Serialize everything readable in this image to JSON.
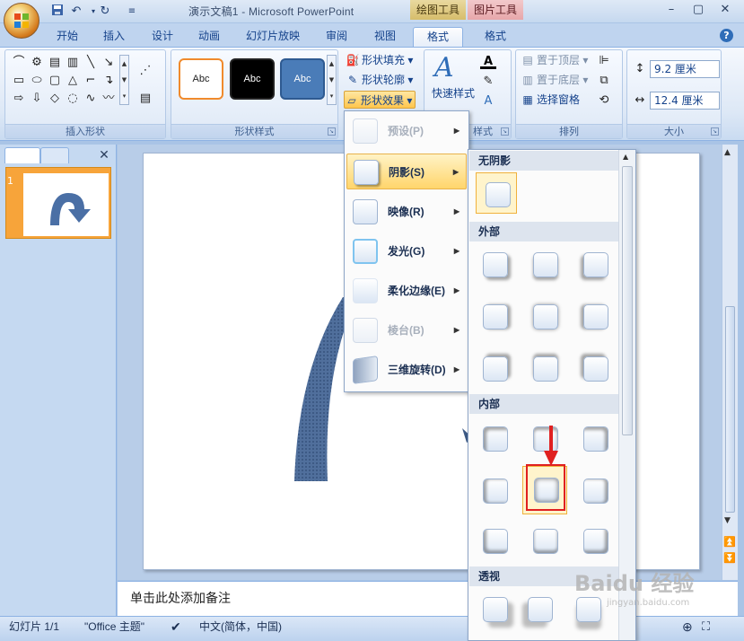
{
  "app": {
    "title": "演示文稿1 - Microsoft PowerPoint",
    "context_tabs": {
      "drawing": "绘图工具",
      "picture": "图片工具"
    }
  },
  "window_controls": {
    "minimize": "–",
    "restore": "▢",
    "close": "✕"
  },
  "tabs": [
    "开始",
    "插入",
    "设计",
    "动画",
    "幻灯片放映",
    "审阅",
    "视图",
    "格式",
    "格式"
  ],
  "active_tab_index": 7,
  "ribbon": {
    "insert_shapes": {
      "label": "插入形状"
    },
    "shape_styles": {
      "label": "形状样式",
      "thumbnails": [
        "Abc",
        "Abc",
        "Abc"
      ],
      "fill": "形状填充",
      "outline": "形状轮廓",
      "effects": "形状效果"
    },
    "wordart": {
      "quick_styles": "快速样式",
      "label_fragment": "样式"
    },
    "arrange": {
      "label": "排列",
      "bring_front": "置于顶层",
      "send_back": "置于底层",
      "selection_pane": "选择窗格"
    },
    "size": {
      "label": "大小",
      "height": "9.2 厘米",
      "width": "12.4 厘米"
    }
  },
  "effects_menu": {
    "items": [
      {
        "label": "预设(P)",
        "disabled": true
      },
      {
        "label": "阴影(S)",
        "disabled": false,
        "hot": true
      },
      {
        "label": "映像(R)",
        "disabled": false
      },
      {
        "label": "发光(G)",
        "disabled": false
      },
      {
        "label": "柔化边缘(E)",
        "disabled": false
      },
      {
        "label": "棱台(B)",
        "disabled": true
      },
      {
        "label": "三维旋转(D)",
        "disabled": false
      }
    ]
  },
  "shadow_gallery": {
    "sections": {
      "none": "无阴影",
      "outer": "外部",
      "inner": "内部",
      "perspective": "透视"
    }
  },
  "notes": {
    "placeholder": "单击此处添加备注"
  },
  "status": {
    "slide": "幻灯片 1/1",
    "theme": "\"Office 主题\"",
    "language": "中文(简体，中国)"
  },
  "slides_panel": {
    "number": "1"
  },
  "watermark": {
    "text": "Baidu 经验",
    "sub": "jingyan.baidu.com"
  },
  "colors": {
    "accent": "#4a6fa5",
    "highlight": "#ffd56b",
    "annotation": "#e02020"
  }
}
